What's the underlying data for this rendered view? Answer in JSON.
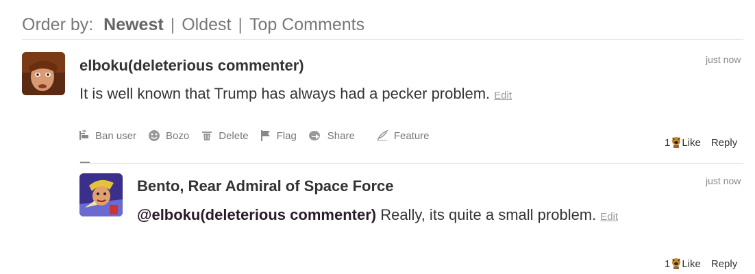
{
  "order": {
    "label": "Order by:",
    "options": [
      "Newest",
      "Oldest",
      "Top Comments"
    ],
    "active": "Newest"
  },
  "comments": [
    {
      "author": "elboku(deleterious commenter)",
      "timestamp": "just now",
      "text": "It is well known that Trump has always had a pecker problem.",
      "edit_label": "Edit",
      "actions": [
        "Ban user",
        "Bozo",
        "Delete",
        "Flag",
        "Share",
        "Feature"
      ],
      "like_count": "1",
      "like_label": "Like",
      "reply_label": "Reply"
    },
    {
      "author": "Bento, Rear Admiral of Space Force",
      "timestamp": "just now",
      "mention": "@elboku(deleterious commenter)",
      "text": "Really, its quite a small problem.",
      "edit_label": "Edit",
      "like_count": "1",
      "like_label": "Like",
      "reply_label": "Reply"
    }
  ],
  "icons": {
    "ban": "ban-user-icon",
    "bozo": "bozo-icon",
    "delete": "trash-icon",
    "flag": "flag-icon",
    "share": "share-icon",
    "feature": "feather-icon",
    "like": "like-icon"
  }
}
